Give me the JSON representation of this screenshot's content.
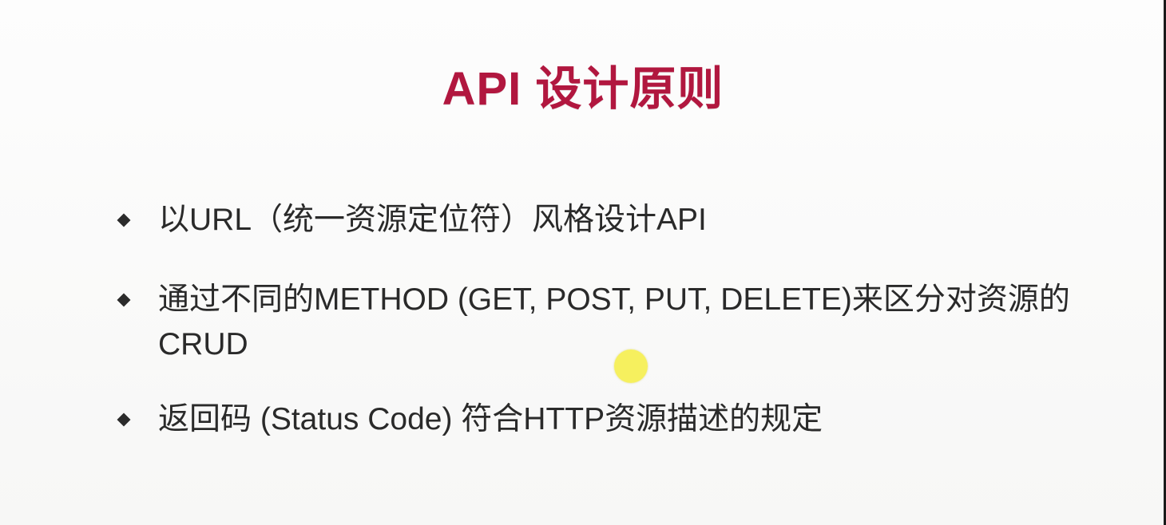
{
  "slide": {
    "title": "API 设计原则",
    "bullets": [
      {
        "text": "以URL（统一资源定位符）风格设计API"
      },
      {
        "text": "通过不同的METHOD (GET, POST, PUT, DELETE)来区分对资源的\nCRUD"
      },
      {
        "text": "返回码 (Status Code) 符合HTTP资源描述的规定"
      }
    ]
  },
  "colors": {
    "title": "#b1173f",
    "text": "#2a2a2a",
    "bullet_marker": "#2b2b2b",
    "cursor_highlight": "#f5ee3c",
    "background": "#fbfbfa"
  },
  "icons": {
    "bullet_marker": "diamond-icon",
    "cursor_highlight": "cursor-highlight-icon"
  }
}
